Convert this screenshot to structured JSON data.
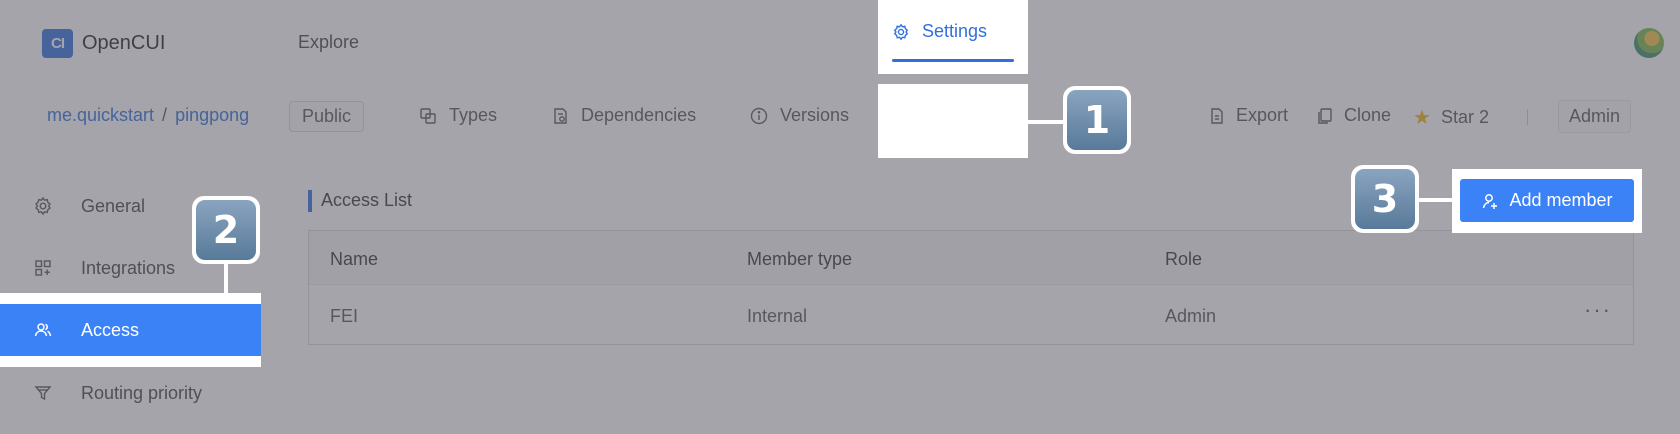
{
  "app": {
    "logo_glyph": "CI",
    "name": "OpenCUI",
    "explore_label": "Explore"
  },
  "breadcrumb": {
    "org": "me.quickstart",
    "separator": "/",
    "project": "pingpong"
  },
  "visibility_badge": "Public",
  "tabs": {
    "types": "Types",
    "dependencies": "Dependencies",
    "versions": "Versions",
    "settings": "Settings"
  },
  "actions": {
    "export": "Export",
    "clone": "Clone",
    "star": "Star 2",
    "admin": "Admin"
  },
  "sidebar": {
    "items": [
      {
        "label": "General",
        "icon": "gear-icon"
      },
      {
        "label": "Integrations",
        "icon": "integrations-icon"
      },
      {
        "label": "Access",
        "icon": "users-icon",
        "active": true
      },
      {
        "label": "Routing priority",
        "icon": "filter-icon"
      }
    ]
  },
  "section": {
    "title": "Access List",
    "add_button": "Add member"
  },
  "table": {
    "headers": [
      "Name",
      "Member type",
      "Role"
    ],
    "rows": [
      {
        "name": "FEI",
        "member_type": "Internal",
        "role": "Admin",
        "more": "···"
      }
    ]
  },
  "callouts": [
    "1",
    "2",
    "3"
  ],
  "colors": {
    "accent": "#2f6fde",
    "active_bg": "#3b82f6",
    "star": "#f0b400"
  }
}
